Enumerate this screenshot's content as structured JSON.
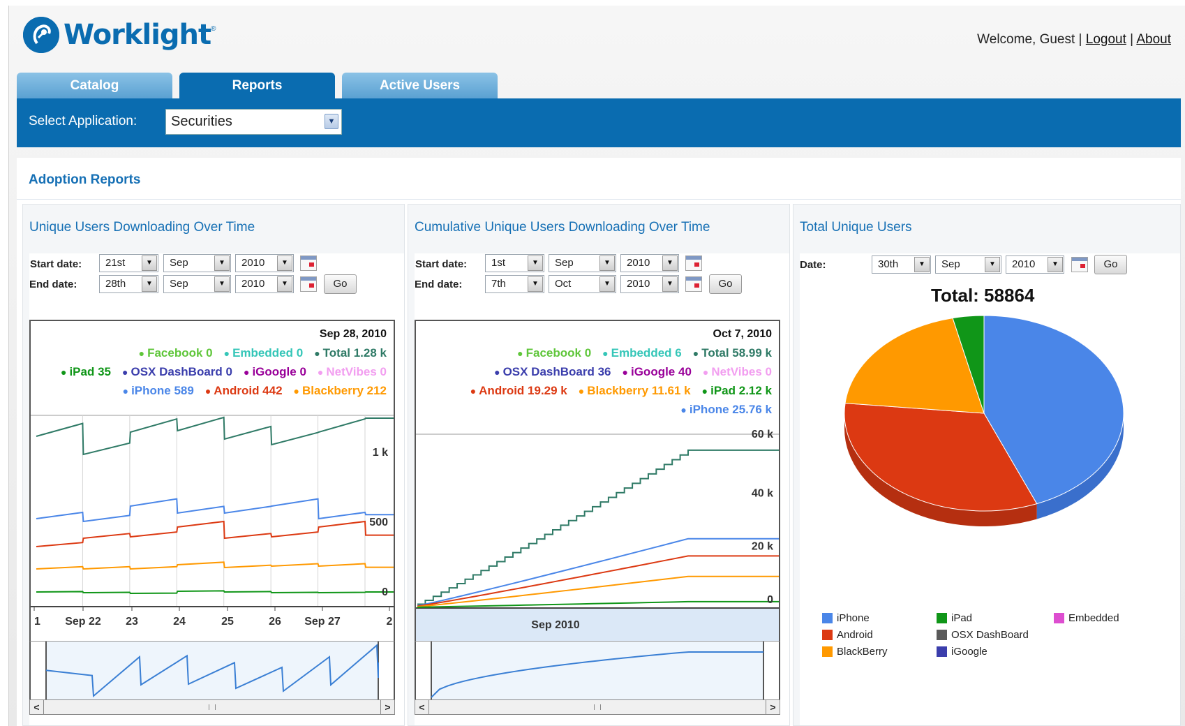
{
  "header": {
    "brand": "Worklight",
    "trademark": "®",
    "welcome": "Welcome, Guest |",
    "logout": "Logout",
    "about": "About",
    "pipe": "|"
  },
  "tabs": [
    {
      "label": "Catalog",
      "active": false
    },
    {
      "label": "Reports",
      "active": true
    },
    {
      "label": "Active Users",
      "active": false
    }
  ],
  "app_select": {
    "label": "Select Application:",
    "value": "Securities"
  },
  "section_title": "Adoption Reports",
  "colors": {
    "brand": "#0a6cb0",
    "iphone": "#4a86e8",
    "android": "#dc3912",
    "blackberry": "#ff9900",
    "ipad": "#109618",
    "osx": "#5a5a5a",
    "igoogle": "#3b3eac",
    "embedded": "#dd4ed0",
    "facebook": "#5fc63a",
    "total": "#2f7a66",
    "netvibes": "#f29ef0"
  },
  "panel1": {
    "title": "Unique Users Downloading Over Time",
    "start_label": "Start date:",
    "end_label": "End date:",
    "start": {
      "day": "21st",
      "month": "Sep",
      "year": "2010"
    },
    "end": {
      "day": "28th",
      "month": "Sep",
      "year": "2010"
    },
    "go": "Go",
    "date": "Sep 28, 2010",
    "legend": [
      [
        {
          "t": "Facebook 0",
          "c": "#5fc63a"
        },
        {
          "t": "Embedded 0",
          "c": "#35c6b8"
        },
        {
          "t": "Total 1.28 k",
          "c": "#2f7a66"
        }
      ],
      [
        {
          "t": "iPad 35",
          "c": "#109618"
        },
        {
          "t": "OSX DashBoard 0",
          "c": "#3b3eac"
        },
        {
          "t": "iGoogle 0",
          "c": "#990099"
        },
        {
          "t": "NetVibes 0",
          "c": "#f29ef0"
        }
      ],
      [
        {
          "t": "iPhone 589",
          "c": "#4a86e8"
        },
        {
          "t": "Android 442",
          "c": "#dc3912"
        },
        {
          "t": "Blackberry 212",
          "c": "#ff9900"
        }
      ]
    ],
    "yticks": [
      "1 k",
      "500",
      "0"
    ],
    "xticks": [
      "1",
      "Sep 22",
      "23",
      "24",
      "25",
      "26",
      "Sep 27",
      "2"
    ]
  },
  "panel2": {
    "title": "Cumulative Unique Users Downloading Over Time",
    "start_label": "Start date:",
    "end_label": "End date:",
    "start": {
      "day": "1st",
      "month": "Sep",
      "year": "2010"
    },
    "end": {
      "day": "7th",
      "month": "Oct",
      "year": "2010"
    },
    "go": "Go",
    "date": "Oct 7, 2010",
    "legend": [
      [
        {
          "t": "Facebook 0",
          "c": "#5fc63a"
        },
        {
          "t": "Embedded 6",
          "c": "#35c6b8"
        },
        {
          "t": "Total 58.99 k",
          "c": "#2f7a66"
        }
      ],
      [
        {
          "t": "OSX DashBoard 36",
          "c": "#3b3eac"
        },
        {
          "t": "iGoogle 40",
          "c": "#990099"
        },
        {
          "t": "NetVibes 0",
          "c": "#f29ef0"
        }
      ],
      [
        {
          "t": "Android 19.29 k",
          "c": "#dc3912"
        },
        {
          "t": "Blackberry 11.61 k",
          "c": "#ff9900"
        },
        {
          "t": "iPad 2.12 k",
          "c": "#109618"
        }
      ],
      [
        {
          "t": "iPhone 25.76 k",
          "c": "#4a86e8"
        }
      ]
    ],
    "yticks": [
      "60 k",
      "40 k",
      "20 k",
      "0"
    ],
    "xlabel": "Sep 2010"
  },
  "panel3": {
    "title": "Total Unique Users",
    "date_label": "Date:",
    "date": {
      "day": "30th",
      "month": "Sep",
      "year": "2010"
    },
    "go": "Go",
    "total": "Total: 58864",
    "legend": [
      {
        "t": "iPhone",
        "c": "#4a86e8"
      },
      {
        "t": "iPad",
        "c": "#109618"
      },
      {
        "t": "Embedded",
        "c": "#dd4ed0"
      },
      {
        "t": "Android",
        "c": "#dc3912"
      },
      {
        "t": "OSX DashBoard",
        "c": "#5a5a5a"
      },
      {
        "t": "BlackBerry",
        "c": "#ff9900"
      },
      {
        "t": "iGoogle",
        "c": "#3b3eac"
      }
    ]
  },
  "chart_data": [
    {
      "type": "line",
      "x": [
        "Sep 21",
        "Sep 22",
        "Sep 23",
        "Sep 24",
        "Sep 25",
        "Sep 26",
        "Sep 27",
        "Sep 28"
      ],
      "series": [
        {
          "name": "Total",
          "values": [
            1150,
            1020,
            1180,
            1190,
            1130,
            1090,
            1180,
            1280
          ]
        },
        {
          "name": "iPhone",
          "values": [
            560,
            540,
            650,
            600,
            600,
            650,
            560,
            589
          ]
        },
        {
          "name": "Android",
          "values": [
            360,
            420,
            430,
            500,
            420,
            430,
            500,
            442
          ]
        },
        {
          "name": "Blackberry",
          "values": [
            200,
            200,
            200,
            230,
            210,
            220,
            220,
            212
          ]
        },
        {
          "name": "iPad",
          "values": [
            35,
            30,
            25,
            40,
            35,
            30,
            30,
            35
          ]
        }
      ],
      "yticks": [
        "1 k",
        "500",
        "0"
      ],
      "ylim": [
        0,
        1300
      ]
    },
    {
      "type": "line",
      "x": [
        "Sep 1",
        "Oct 7"
      ],
      "series": [
        {
          "name": "Total",
          "values": [
            0,
            58990
          ]
        },
        {
          "name": "iPhone",
          "values": [
            0,
            25760
          ]
        },
        {
          "name": "Android",
          "values": [
            0,
            19290
          ]
        },
        {
          "name": "Blackberry",
          "values": [
            0,
            11610
          ]
        },
        {
          "name": "iPad",
          "values": [
            0,
            2120
          ]
        }
      ],
      "yticks": [
        "60 k",
        "40 k",
        "20 k",
        "0"
      ],
      "ylim": [
        0,
        65000
      ]
    },
    {
      "type": "pie",
      "title": "Total: 58864",
      "labels": [
        "iPhone",
        "Android",
        "BlackBerry",
        "iPad"
      ],
      "values": [
        25760,
        19290,
        11610,
        2120
      ]
    }
  ]
}
